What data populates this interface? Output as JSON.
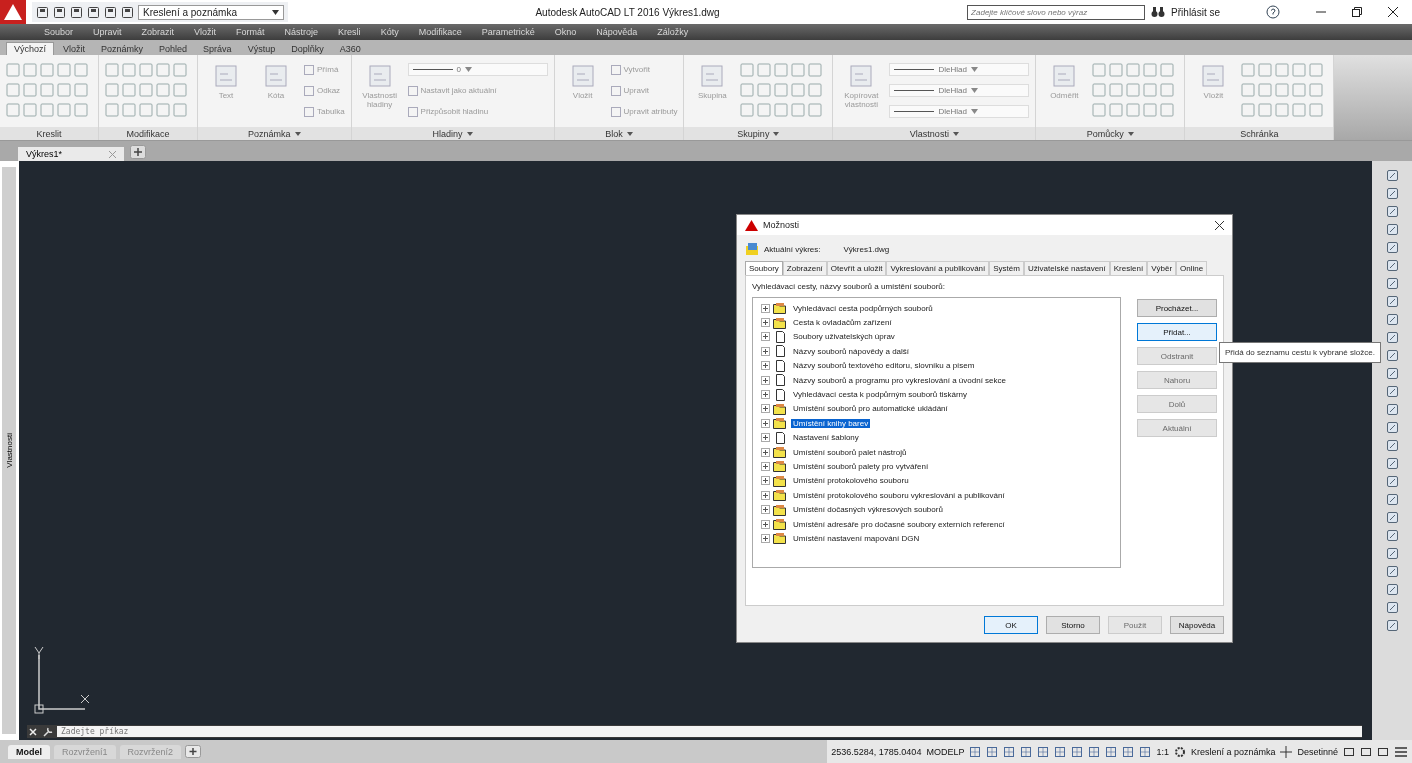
{
  "title_bar": {
    "workspace": "Kreslení a poznámka",
    "title": "Autodesk AutoCAD LT 2016  Výkres1.dwg",
    "search": {
      "placeholder": "Zadejte klíčové slovo nebo výraz"
    },
    "sign_in": "Přihlásit se"
  },
  "menu_bar": [
    "Soubor",
    "Upravit",
    "Zobrazit",
    "Vložit",
    "Formát",
    "Nástroje",
    "Kresli",
    "Kóty",
    "Modifikace",
    "Parametrické",
    "Okno",
    "Nápověda",
    "Záložky"
  ],
  "ribbon_tabs": [
    {
      "label": "Výchozí",
      "selected": true
    },
    {
      "label": "Vložit",
      "selected": false
    },
    {
      "label": "Poznámky",
      "selected": false
    },
    {
      "label": "Pohled",
      "selected": false
    },
    {
      "label": "Správa",
      "selected": false
    },
    {
      "label": "Výstup",
      "selected": false
    },
    {
      "label": "Doplňky",
      "selected": false
    },
    {
      "label": "A360",
      "selected": false
    }
  ],
  "ribbon_panels": [
    {
      "title": "Kreslit",
      "has_menu": false,
      "items": [
        {
          "kind": "icons"
        }
      ]
    },
    {
      "title": "Modifikace",
      "has_menu": false,
      "items": [
        {
          "kind": "icons"
        }
      ]
    },
    {
      "title": "Poznámka",
      "has_menu": true,
      "items": [
        {
          "kind": "large",
          "label": "Text"
        },
        {
          "kind": "large",
          "label": "Kóta"
        },
        {
          "kind": "small",
          "label": "Přímá"
        },
        {
          "kind": "small",
          "label": "Odkaz"
        },
        {
          "kind": "small",
          "label": "Tabulka"
        }
      ]
    },
    {
      "title": "Hladiny",
      "has_menu": true,
      "items": [
        {
          "kind": "large",
          "label": "Vlastnosti hladiny"
        },
        {
          "kind": "combo",
          "label": "0"
        },
        {
          "kind": "small",
          "label": "Nastavit jako aktuální"
        },
        {
          "kind": "small",
          "label": "Přizpůsobit hladinu"
        }
      ]
    },
    {
      "title": "Blok",
      "has_menu": true,
      "items": [
        {
          "kind": "large",
          "label": "Vložit"
        },
        {
          "kind": "small",
          "label": "Vytvořit"
        },
        {
          "kind": "small",
          "label": "Upravit"
        },
        {
          "kind": "small",
          "label": "Upravit atributy"
        }
      ]
    },
    {
      "title": "Skupiny",
      "has_menu": true,
      "items": [
        {
          "kind": "large",
          "label": "Skupina"
        },
        {
          "kind": "icons"
        }
      ]
    },
    {
      "title": "Vlastnosti",
      "has_menu": true,
      "items": [
        {
          "kind": "large",
          "label": "Kopírovat vlastnosti"
        },
        {
          "kind": "combo",
          "label": "DleHlad"
        },
        {
          "kind": "combo",
          "label": "DleHlad"
        },
        {
          "kind": "combo",
          "label": "DleHlad"
        }
      ]
    },
    {
      "title": "Pomůcky",
      "has_menu": true,
      "items": [
        {
          "kind": "large",
          "label": "Odměřit"
        },
        {
          "kind": "icons"
        }
      ]
    },
    {
      "title": "Schránka",
      "has_menu": false,
      "items": [
        {
          "kind": "large",
          "label": "Vložit"
        },
        {
          "kind": "icons"
        }
      ]
    }
  ],
  "document_tabs": [
    {
      "label": "Výkres1*",
      "selected": true
    }
  ],
  "side_palette": "Vlastnosti",
  "command_line": {
    "placeholder": "Zadejte příkaz"
  },
  "dialog": {
    "title": "Možnosti",
    "current_drawing_label": "Aktuální výkres:",
    "current_drawing": "Výkres1.dwg",
    "tabs": [
      {
        "label": "Soubory",
        "selected": true
      },
      {
        "label": "Zobrazení",
        "selected": false
      },
      {
        "label": "Otevřít a uložit",
        "selected": false
      },
      {
        "label": "Vykreslování a publikování",
        "selected": false
      },
      {
        "label": "Systém",
        "selected": false
      },
      {
        "label": "Uživatelské nastavení",
        "selected": false
      },
      {
        "label": "Kreslení",
        "selected": false
      },
      {
        "label": "Výběr",
        "selected": false
      },
      {
        "label": "Online",
        "selected": false
      }
    ],
    "tree_label": "Vyhledávací cesty, názvy souborů a umístění souborů:",
    "tree": [
      {
        "kind": "folder",
        "label": "Vyhledávací cesta podpůrných souborů",
        "selected": false
      },
      {
        "kind": "folder",
        "label": "Cesta k ovladačům zařízení",
        "selected": false
      },
      {
        "kind": "file",
        "label": "Soubory uživatelských úprav",
        "selected": false
      },
      {
        "kind": "file",
        "label": "Názvy souborů nápovědy a další",
        "selected": false
      },
      {
        "kind": "file",
        "label": "Názvy souborů textového editoru, slovníku a písem",
        "selected": false
      },
      {
        "kind": "file",
        "label": "Názvy souborů a programu pro vykreslování a úvodní sekce",
        "selected": false
      },
      {
        "kind": "file",
        "label": "Vyhledávací cesta k podpůrným souborů tiskárny",
        "selected": false
      },
      {
        "kind": "folder",
        "label": "Umístění souborů pro automatické ukládání",
        "selected": false
      },
      {
        "kind": "folder",
        "label": "Umístění knihy barev",
        "selected": true
      },
      {
        "kind": "file",
        "label": "Nastavení šablony",
        "selected": false
      },
      {
        "kind": "folder",
        "label": "Umístění souborů palet nástrojů",
        "selected": false
      },
      {
        "kind": "folder",
        "label": "Umístění souborů palety pro vytváření",
        "selected": false
      },
      {
        "kind": "folder",
        "label": "Umístění protokolového souboru",
        "selected": false
      },
      {
        "kind": "folder",
        "label": "Umístění protokolového souboru vykreslování a publikování",
        "selected": false
      },
      {
        "kind": "folder",
        "label": "Umístění dočasných výkresových souborů",
        "selected": false
      },
      {
        "kind": "folder",
        "label": "Umístění adresáře pro dočasné soubory externích referencí",
        "selected": false
      },
      {
        "kind": "folder",
        "label": "Umístění nastavení mapování DGN",
        "selected": false
      }
    ],
    "side_buttons": [
      {
        "label": "Procházet...",
        "disabled": false,
        "focused": false
      },
      {
        "label": "Přidat...",
        "disabled": false,
        "focused": true
      },
      {
        "label": "Odstranit",
        "disabled": true,
        "focused": false
      },
      {
        "label": "Nahoru",
        "disabled": true,
        "focused": false
      },
      {
        "label": "Dolů",
        "disabled": true,
        "focused": false
      },
      {
        "label": "Aktuální",
        "disabled": true,
        "focused": false
      }
    ],
    "tooltip": "Přidá do seznamu cestu k vybrané složce.",
    "footer_buttons": [
      {
        "label": "OK",
        "disabled": false,
        "focused": true
      },
      {
        "label": "Storno",
        "disabled": false,
        "focused": false
      },
      {
        "label": "Použít",
        "disabled": true,
        "focused": false
      },
      {
        "label": "Nápověda",
        "disabled": false,
        "focused": false
      }
    ]
  },
  "status_bar": {
    "layout_tabs": [
      {
        "label": "Model",
        "selected": true
      },
      {
        "label": "Rozvržení1",
        "selected": false
      },
      {
        "label": "Rozvržení2",
        "selected": false
      }
    ],
    "coordinates": "2536.5284, 1785.0404",
    "space": "MODELP",
    "scale": "1:1",
    "workspace": "Kreslení a poznámka",
    "units": "Desetinné"
  }
}
